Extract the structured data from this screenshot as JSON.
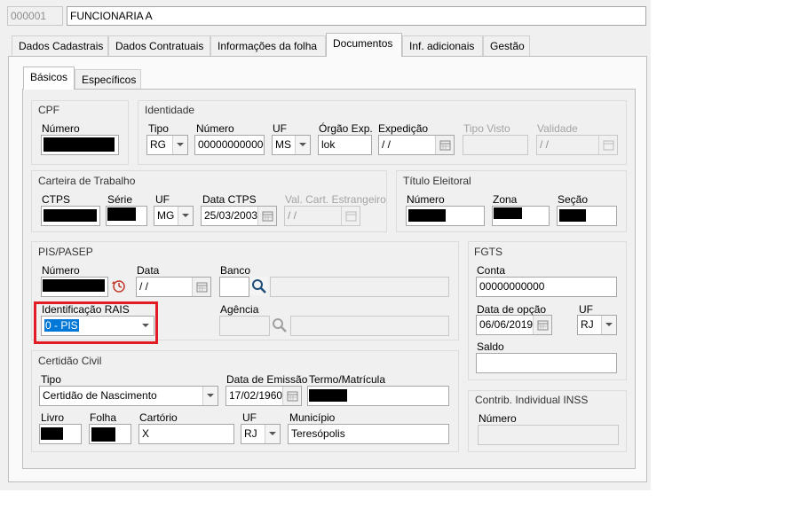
{
  "header": {
    "code": "000001",
    "name": "FUNCIONARIA A"
  },
  "tabs": [
    "Dados Cadastrais",
    "Dados Contratuais",
    "Informações da folha",
    "Documentos",
    "Inf. adicionais",
    "Gestão"
  ],
  "subtabs": [
    "Básicos",
    "Específicos"
  ],
  "cpf": {
    "title": "CPF",
    "numero_label": "Número"
  },
  "identidade": {
    "title": "Identidade",
    "tipo_label": "Tipo",
    "tipo_value": "RG",
    "numero_label": "Número",
    "numero_value": "0000000000000",
    "uf_label": "UF",
    "uf_value": "MS",
    "orgao_label": "Órgão Exp.",
    "orgao_value": "lok",
    "expedicao_label": "Expedição",
    "expedicao_value": " / /",
    "tipo_visto_label": "Tipo Visto",
    "validade_label": "Validade",
    "validade_value": " / /"
  },
  "carteira": {
    "title": "Carteira de Trabalho",
    "ctps_label": "CTPS",
    "serie_label": "Série",
    "uf_label": "UF",
    "uf_value": "MG",
    "data_label": "Data CTPS",
    "data_value": "25/03/2003",
    "val_label": "Val. Cart. Estrangeiro",
    "val_value": " / /"
  },
  "titulo": {
    "title": "Título Eleitoral",
    "numero_label": "Número",
    "zona_label": "Zona",
    "secao_label": "Seção"
  },
  "pis": {
    "title": "PIS/PASEP",
    "numero_label": "Número",
    "data_label": "Data",
    "data_value": " / /",
    "banco_label": "Banco",
    "rais_label": "Identificação RAIS",
    "rais_value": "0 - PIS",
    "agencia_label": "Agência"
  },
  "fgts": {
    "title": "FGTS",
    "conta_label": "Conta",
    "conta_value": "00000000000",
    "data_label": "Data de opção",
    "data_value": "06/06/2019",
    "uf_label": "UF",
    "uf_value": "RJ",
    "saldo_label": "Saldo"
  },
  "certidao": {
    "title": "Certidão Civil",
    "tipo_label": "Tipo",
    "tipo_value": "Certidão de Nascimento",
    "emissao_label": "Data de Emissão",
    "emissao_value": "17/02/1960",
    "termo_label": "Termo/Matrícula",
    "livro_label": "Livro",
    "folha_label": "Folha",
    "cartorio_label": "Cartório",
    "cartorio_value": "X",
    "uf_label": "UF",
    "uf_value": "RJ",
    "municipio_label": "Município",
    "municipio_value": "Teresópolis"
  },
  "inss": {
    "title": "Contrib. Individual INSS",
    "numero_label": "Número"
  },
  "colors": {
    "highlight": "#e11c24",
    "selection": "#0078d7"
  }
}
